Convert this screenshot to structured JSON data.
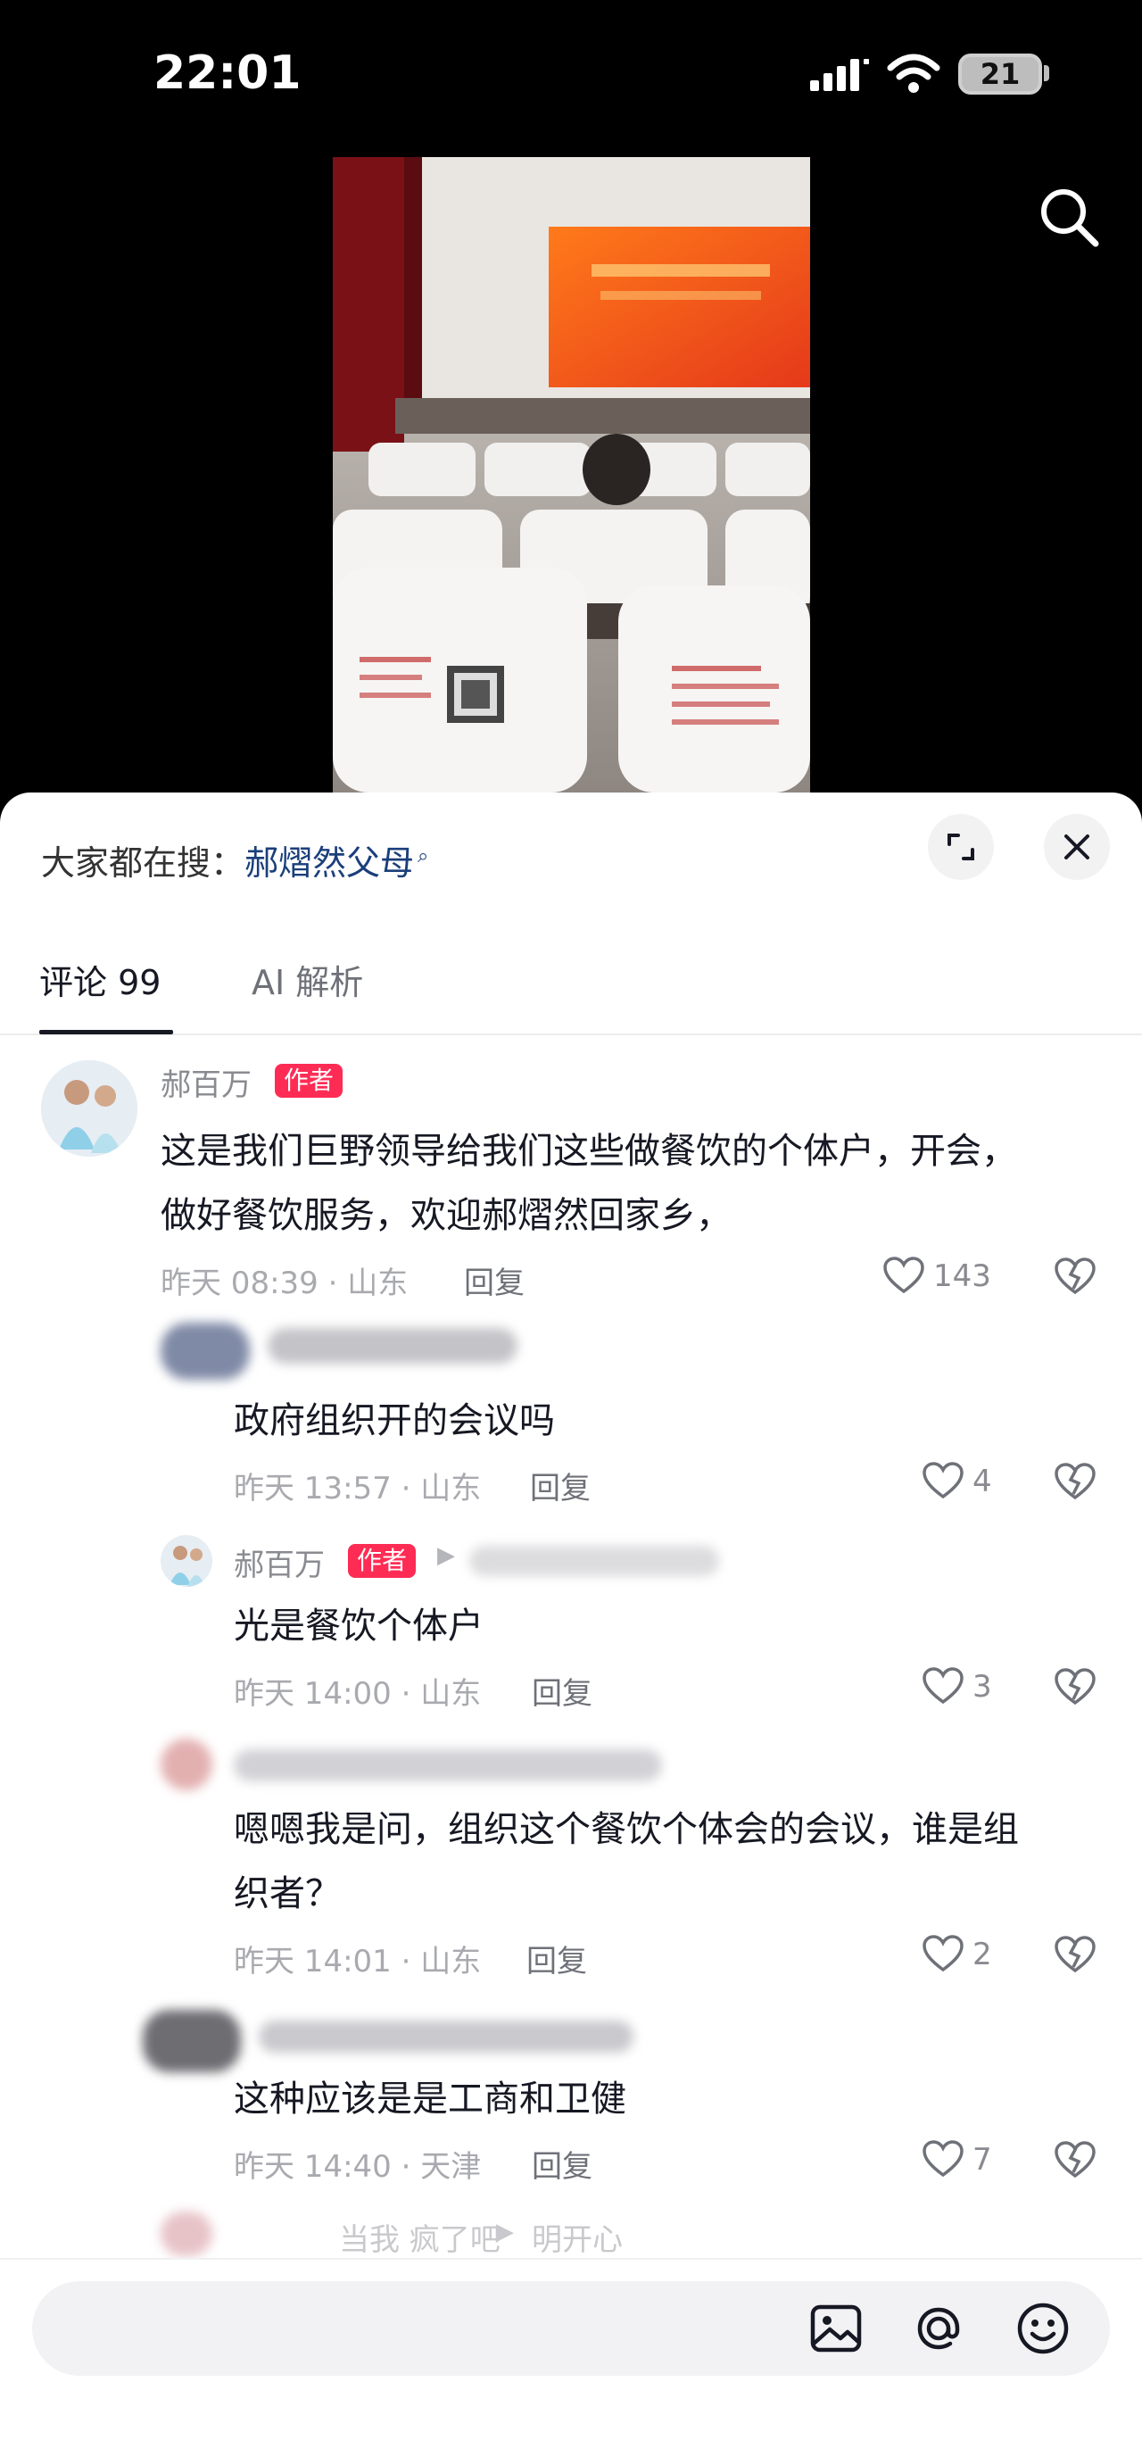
{
  "status_bar": {
    "time": "22:01",
    "battery": "21"
  },
  "search_hint": {
    "prefix": "大家都在搜：",
    "term": "郝熠然父母"
  },
  "tabs": [
    {
      "label": "评论 99"
    },
    {
      "label": "AI 解析"
    }
  ],
  "comments": [
    {
      "username": "郝百万",
      "badge": "作者",
      "text_line1": "这是我们巨野领导给我们这些做餐饮的个体户，开会，",
      "text_line2": "做好餐饮服务，欢迎郝熠然回家乡，",
      "meta": "昨天 08:39 · 山东",
      "reply_label": "回复",
      "likes": "143"
    },
    {
      "username": "",
      "text_line1": "政府组织开的会议吗",
      "meta": "昨天 13:57 · 山东",
      "reply_label": "回复",
      "likes": "4"
    },
    {
      "username": "郝百万",
      "badge": "作者",
      "reply_to": "",
      "text_line1": "光是餐饮个体户",
      "meta": "昨天 14:00 · 山东",
      "reply_label": "回复",
      "likes": "3"
    },
    {
      "username": "",
      "text_line1": "嗯嗯我是问，组织这个餐饮个体会的会议，谁是组",
      "text_line2": "织者？",
      "meta": "昨天 14:01 · 山东",
      "reply_label": "回复",
      "likes": "2"
    },
    {
      "username": "",
      "text_line1": "这种应该是是工商和卫健",
      "meta": "昨天 14:40 · 天津",
      "reply_label": "回复",
      "likes": "7"
    },
    {
      "username": "当我 疯了吧",
      "reply_to": "明开心"
    }
  ],
  "bottom_bar": {
    "input_placeholder": "",
    "icons": [
      "image-icon",
      "at-icon",
      "emoji-icon"
    ]
  },
  "colors": {
    "author_badge": "#fe2c55",
    "search_term": "#1a3f7a"
  }
}
